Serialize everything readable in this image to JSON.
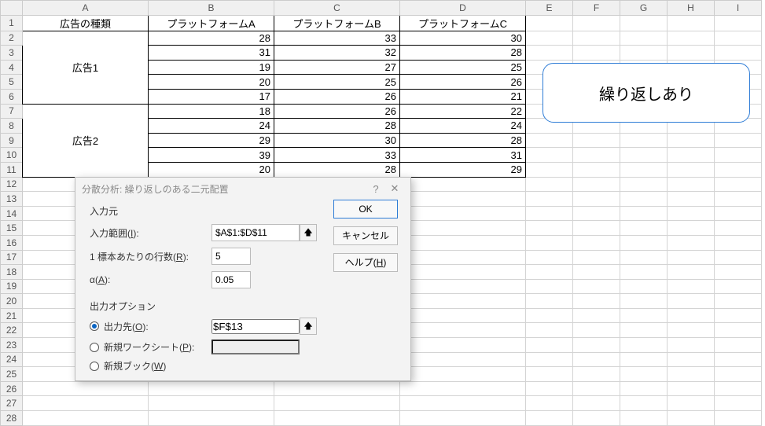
{
  "columns": [
    "A",
    "B",
    "C",
    "D",
    "E",
    "F",
    "G",
    "H",
    "I"
  ],
  "headers": {
    "A1": "広告の種類",
    "B1": "プラットフォームA",
    "C1": "プラットフォームB",
    "D1": "プラットフォームC"
  },
  "rowlabels": {
    "A2_6": "広告1",
    "A7_11": "広告2"
  },
  "data": {
    "r2": {
      "B": "28",
      "C": "33",
      "D": "30"
    },
    "r3": {
      "B": "31",
      "C": "32",
      "D": "28"
    },
    "r4": {
      "B": "19",
      "C": "27",
      "D": "25"
    },
    "r5": {
      "B": "20",
      "C": "25",
      "D": "26"
    },
    "r6": {
      "B": "17",
      "C": "26",
      "D": "21"
    },
    "r7": {
      "B": "18",
      "C": "26",
      "D": "22"
    },
    "r8": {
      "B": "24",
      "C": "28",
      "D": "24"
    },
    "r9": {
      "B": "29",
      "C": "30",
      "D": "28"
    },
    "r10": {
      "B": "39",
      "C": "33",
      "D": "31"
    },
    "r11": {
      "B": "20",
      "C": "28",
      "D": "29"
    }
  },
  "callout": "繰り返しあり",
  "dialog": {
    "title": "分散分析: 繰り返しのある二元配置",
    "help_glyph": "?",
    "close_glyph": "✕",
    "section_input": "入力元",
    "input_range_label": "入力範囲(",
    "input_range_key": "I",
    "input_range_label2": "):",
    "input_range_value": "$A$1:$D$11",
    "rows_per_sample_label": "1 標本あたりの行数(",
    "rows_per_sample_key": "R",
    "rows_per_sample_label2": "):",
    "rows_per_sample_value": "5",
    "alpha_label": "α(",
    "alpha_key": "A",
    "alpha_label2": "):",
    "alpha_value": "0.05",
    "section_output": "出力オプション",
    "out_range_label": "出力先(",
    "out_range_key": "O",
    "out_range_label2": "):",
    "out_range_value": "$F$13",
    "new_ws_label": "新規ワークシート(",
    "new_ws_key": "P",
    "new_ws_label2": "):",
    "new_wb_label": "新規ブック(",
    "new_wb_key": "W",
    "new_wb_label2": ")",
    "ok": "OK",
    "cancel": "キャンセル",
    "help": "ヘルプ(",
    "help_key": "H",
    "help2": ")",
    "picker_glyph": "🡅"
  }
}
